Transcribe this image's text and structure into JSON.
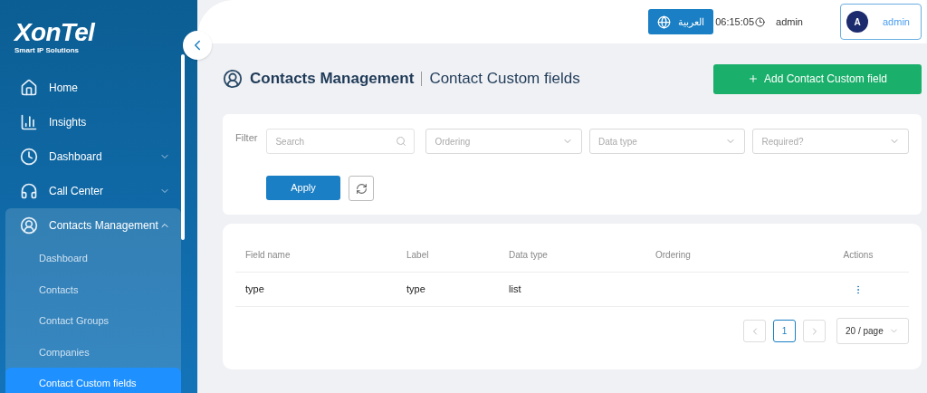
{
  "logo": {
    "name": "XonTel",
    "tagline": "Smart IP Solutions"
  },
  "sidebar": {
    "items": [
      {
        "label": "Home",
        "kind": "link"
      },
      {
        "label": "Insights",
        "kind": "link"
      },
      {
        "label": "Dashboard",
        "kind": "group",
        "expanded": false
      },
      {
        "label": "Call Center",
        "kind": "group",
        "expanded": false
      },
      {
        "label": "Contacts Management",
        "kind": "group",
        "expanded": true,
        "children": [
          {
            "label": "Dashboard",
            "selected": false
          },
          {
            "label": "Contacts",
            "selected": false
          },
          {
            "label": "Contact Groups",
            "selected": false
          },
          {
            "label": "Companies",
            "selected": false
          },
          {
            "label": "Contact Custom fields",
            "selected": true
          }
        ]
      }
    ]
  },
  "header": {
    "language_button": "العربية",
    "time": "06:15:05",
    "user": "admin",
    "avatar_letter": "A",
    "profile_name": "admin"
  },
  "page": {
    "title": "Contacts Management",
    "subtitle": "Contact Custom fields",
    "add_button": "Add Contact Custom field"
  },
  "filter": {
    "label": "Filter",
    "search": {
      "placeholder": "Search"
    },
    "selects": [
      {
        "placeholder": "Ordering"
      },
      {
        "placeholder": "Data type"
      },
      {
        "placeholder": "Required?"
      }
    ],
    "apply_button": "Apply"
  },
  "table": {
    "columns": [
      "Field name",
      "Label",
      "Data type",
      "Ordering",
      "Actions"
    ],
    "rows": [
      {
        "field_name": "type",
        "label": "type",
        "data_type": "list"
      }
    ]
  },
  "pagination": {
    "pages": [
      {
        "label": "1",
        "selected": true
      }
    ],
    "page_size": "20 / page"
  }
}
